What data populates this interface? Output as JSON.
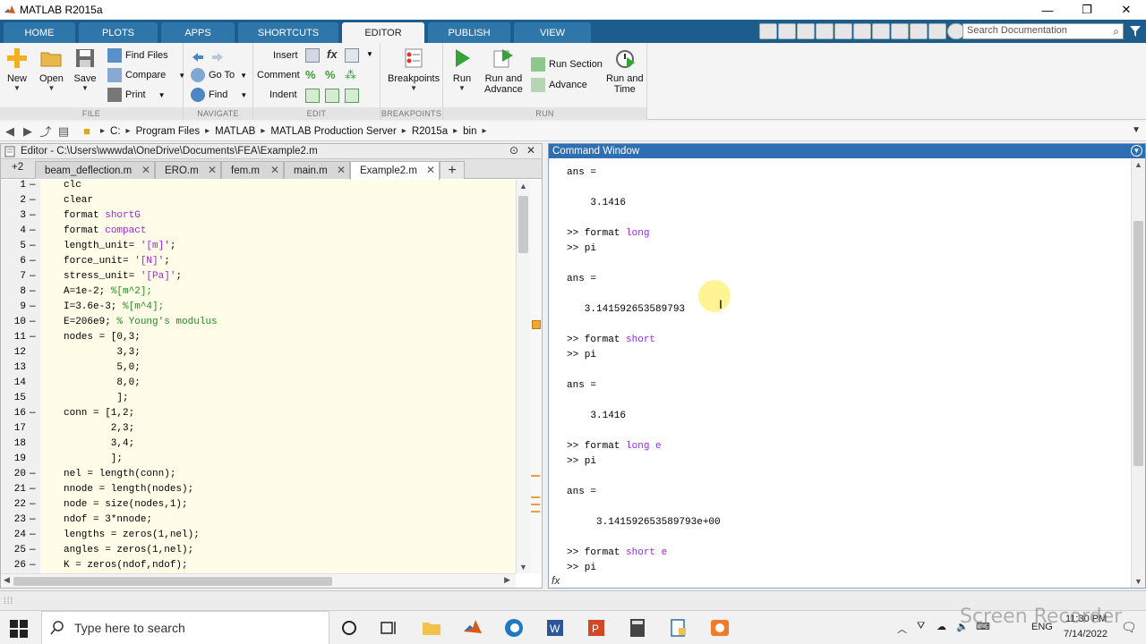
{
  "window": {
    "title": "MATLAB R2015a",
    "controls": [
      "—",
      "❐",
      "✕"
    ]
  },
  "ribbon_tabs": [
    {
      "label": "HOME",
      "active": false
    },
    {
      "label": "PLOTS",
      "active": false
    },
    {
      "label": "APPS",
      "active": false
    },
    {
      "label": "SHORTCUTS",
      "active": false
    },
    {
      "label": "EDITOR",
      "active": true
    },
    {
      "label": "PUBLISH",
      "active": false
    },
    {
      "label": "VIEW",
      "active": false
    }
  ],
  "search_doc": {
    "placeholder": "Search Documentation"
  },
  "ribbon": {
    "file": {
      "label": "FILE",
      "new": "New",
      "open": "Open",
      "save": "Save",
      "find_files": "Find Files",
      "compare": "Compare",
      "print": "Print"
    },
    "navigate": {
      "label": "NAVIGATE",
      "go_to": "Go To",
      "find": "Find"
    },
    "edit": {
      "label": "EDIT",
      "insert": "Insert",
      "comment": "Comment",
      "indent": "Indent",
      "fx": "fx"
    },
    "breakpoints": {
      "label": "BREAKPOINTS",
      "button": "Breakpoints"
    },
    "run": {
      "label": "RUN",
      "run": "Run",
      "run_and_advance_1": "Run and",
      "run_and_advance_2": "Advance",
      "run_section": "Run Section",
      "advance": "Advance",
      "run_and_time_1": "Run and",
      "run_and_time_2": "Time"
    }
  },
  "address": {
    "crumbs": [
      "C:",
      "Program Files",
      "MATLAB",
      "MATLAB Production Server",
      "R2015a",
      "bin"
    ]
  },
  "editor": {
    "title": "Editor - C:\\Users\\wwwda\\OneDrive\\Documents\\FEA\\Example2.m",
    "tab_count": "+2",
    "tabs": [
      {
        "label": "beam_deflection.m",
        "active": false
      },
      {
        "label": "ERO.m",
        "active": false
      },
      {
        "label": "fem.m",
        "active": false
      },
      {
        "label": "main.m",
        "active": false
      },
      {
        "label": "Example2.m",
        "active": true
      }
    ],
    "lines": [
      {
        "n": "1",
        "d": "—",
        "parts": [
          [
            "clc",
            ""
          ]
        ]
      },
      {
        "n": "2",
        "d": "—",
        "parts": [
          [
            "clear",
            ""
          ]
        ]
      },
      {
        "n": "3",
        "d": "—",
        "parts": [
          [
            "format ",
            ""
          ],
          [
            "shortG",
            "str"
          ]
        ]
      },
      {
        "n": "4",
        "d": "—",
        "parts": [
          [
            "format ",
            ""
          ],
          [
            "compact",
            "str"
          ]
        ]
      },
      {
        "n": "5",
        "d": "—",
        "parts": [
          [
            "length_unit= ",
            ""
          ],
          [
            "'[m]'",
            "str"
          ],
          [
            ";",
            ""
          ]
        ]
      },
      {
        "n": "6",
        "d": "—",
        "parts": [
          [
            "force_unit= ",
            ""
          ],
          [
            "'[N]'",
            "str"
          ],
          [
            ";",
            ""
          ]
        ]
      },
      {
        "n": "7",
        "d": "—",
        "parts": [
          [
            "stress_unit= ",
            ""
          ],
          [
            "'[Pa]'",
            "str"
          ],
          [
            ";",
            ""
          ]
        ]
      },
      {
        "n": "8",
        "d": "—",
        "parts": [
          [
            "A=1e-2; ",
            ""
          ],
          [
            "%[m^2];",
            "cmt"
          ]
        ]
      },
      {
        "n": "9",
        "d": "—",
        "parts": [
          [
            "I=3.6e-3; ",
            ""
          ],
          [
            "%[m^4];",
            "cmt"
          ]
        ]
      },
      {
        "n": "10",
        "d": "—",
        "parts": [
          [
            "E=206e9; ",
            ""
          ],
          [
            "% Young's modulus",
            "cmt"
          ]
        ]
      },
      {
        "n": "11",
        "d": "—",
        "parts": [
          [
            "nodes = [0,3;",
            ""
          ]
        ]
      },
      {
        "n": "12",
        "d": "",
        "parts": [
          [
            "         3,3;",
            ""
          ]
        ]
      },
      {
        "n": "13",
        "d": "",
        "parts": [
          [
            "         5,0;",
            ""
          ]
        ]
      },
      {
        "n": "14",
        "d": "",
        "parts": [
          [
            "         8,0;",
            ""
          ]
        ]
      },
      {
        "n": "15",
        "d": "",
        "parts": [
          [
            "         ];",
            ""
          ]
        ]
      },
      {
        "n": "16",
        "d": "—",
        "parts": [
          [
            "conn = [1,2;",
            ""
          ]
        ]
      },
      {
        "n": "17",
        "d": "",
        "parts": [
          [
            "        2,3;",
            ""
          ]
        ]
      },
      {
        "n": "18",
        "d": "",
        "parts": [
          [
            "        3,4;",
            ""
          ]
        ]
      },
      {
        "n": "19",
        "d": "",
        "parts": [
          [
            "        ];",
            ""
          ]
        ]
      },
      {
        "n": "20",
        "d": "—",
        "parts": [
          [
            "nel = length(conn);",
            ""
          ]
        ]
      },
      {
        "n": "21",
        "d": "—",
        "parts": [
          [
            "nnode = length(nodes);",
            ""
          ]
        ]
      },
      {
        "n": "22",
        "d": "—",
        "parts": [
          [
            "node = size(nodes,1);",
            ""
          ]
        ]
      },
      {
        "n": "23",
        "d": "—",
        "parts": [
          [
            "ndof = 3*nnode;",
            ""
          ]
        ]
      },
      {
        "n": "24",
        "d": "—",
        "parts": [
          [
            "lengths = zeros(1,nel);",
            ""
          ]
        ]
      },
      {
        "n": "25",
        "d": "—",
        "parts": [
          [
            "angles = zeros(1,nel);",
            ""
          ]
        ]
      },
      {
        "n": "26",
        "d": "—",
        "parts": [
          [
            "K = zeros(ndof,ndof);",
            ""
          ]
        ]
      }
    ]
  },
  "command_window": {
    "title": "Command Window",
    "lines": [
      {
        "parts": [
          [
            "ans =",
            ""
          ]
        ]
      },
      {
        "parts": [
          [
            "",
            ""
          ]
        ]
      },
      {
        "parts": [
          [
            "    3.1416",
            ""
          ]
        ]
      },
      {
        "parts": [
          [
            "",
            ""
          ]
        ]
      },
      {
        "parts": [
          [
            ">> format ",
            ""
          ],
          [
            "long",
            "str"
          ]
        ]
      },
      {
        "parts": [
          [
            ">> pi",
            ""
          ]
        ]
      },
      {
        "parts": [
          [
            "",
            ""
          ]
        ]
      },
      {
        "parts": [
          [
            "ans =",
            ""
          ]
        ]
      },
      {
        "parts": [
          [
            "",
            ""
          ]
        ]
      },
      {
        "parts": [
          [
            "   3.141592653589793",
            ""
          ]
        ]
      },
      {
        "parts": [
          [
            "",
            ""
          ]
        ]
      },
      {
        "parts": [
          [
            ">> format ",
            ""
          ],
          [
            "short",
            "str"
          ]
        ]
      },
      {
        "parts": [
          [
            ">> pi",
            ""
          ]
        ]
      },
      {
        "parts": [
          [
            "",
            ""
          ]
        ]
      },
      {
        "parts": [
          [
            "ans =",
            ""
          ]
        ]
      },
      {
        "parts": [
          [
            "",
            ""
          ]
        ]
      },
      {
        "parts": [
          [
            "    3.1416",
            ""
          ]
        ]
      },
      {
        "parts": [
          [
            "",
            ""
          ]
        ]
      },
      {
        "parts": [
          [
            ">> format ",
            ""
          ],
          [
            "long e",
            "str"
          ]
        ]
      },
      {
        "parts": [
          [
            ">> pi",
            ""
          ]
        ]
      },
      {
        "parts": [
          [
            "",
            ""
          ]
        ]
      },
      {
        "parts": [
          [
            "ans =",
            ""
          ]
        ]
      },
      {
        "parts": [
          [
            "",
            ""
          ]
        ]
      },
      {
        "parts": [
          [
            "     3.141592653589793e+00",
            ""
          ]
        ]
      },
      {
        "parts": [
          [
            "",
            ""
          ]
        ]
      },
      {
        "parts": [
          [
            ">> format ",
            ""
          ],
          [
            "short e",
            "str"
          ]
        ]
      },
      {
        "parts": [
          [
            ">> pi",
            ""
          ]
        ]
      }
    ],
    "prompt_symbol": "fx"
  },
  "taskbar": {
    "search_placeholder": "Type here to search",
    "lang": "ENG",
    "time": "11:30 PM",
    "date": "7/14/2022"
  },
  "watermark": "Screen Recorder",
  "colors": {
    "string": "#a020f0",
    "comment": "#228b22",
    "tab_bar": "#1c5d8e",
    "command_header": "#2e6fb3"
  }
}
